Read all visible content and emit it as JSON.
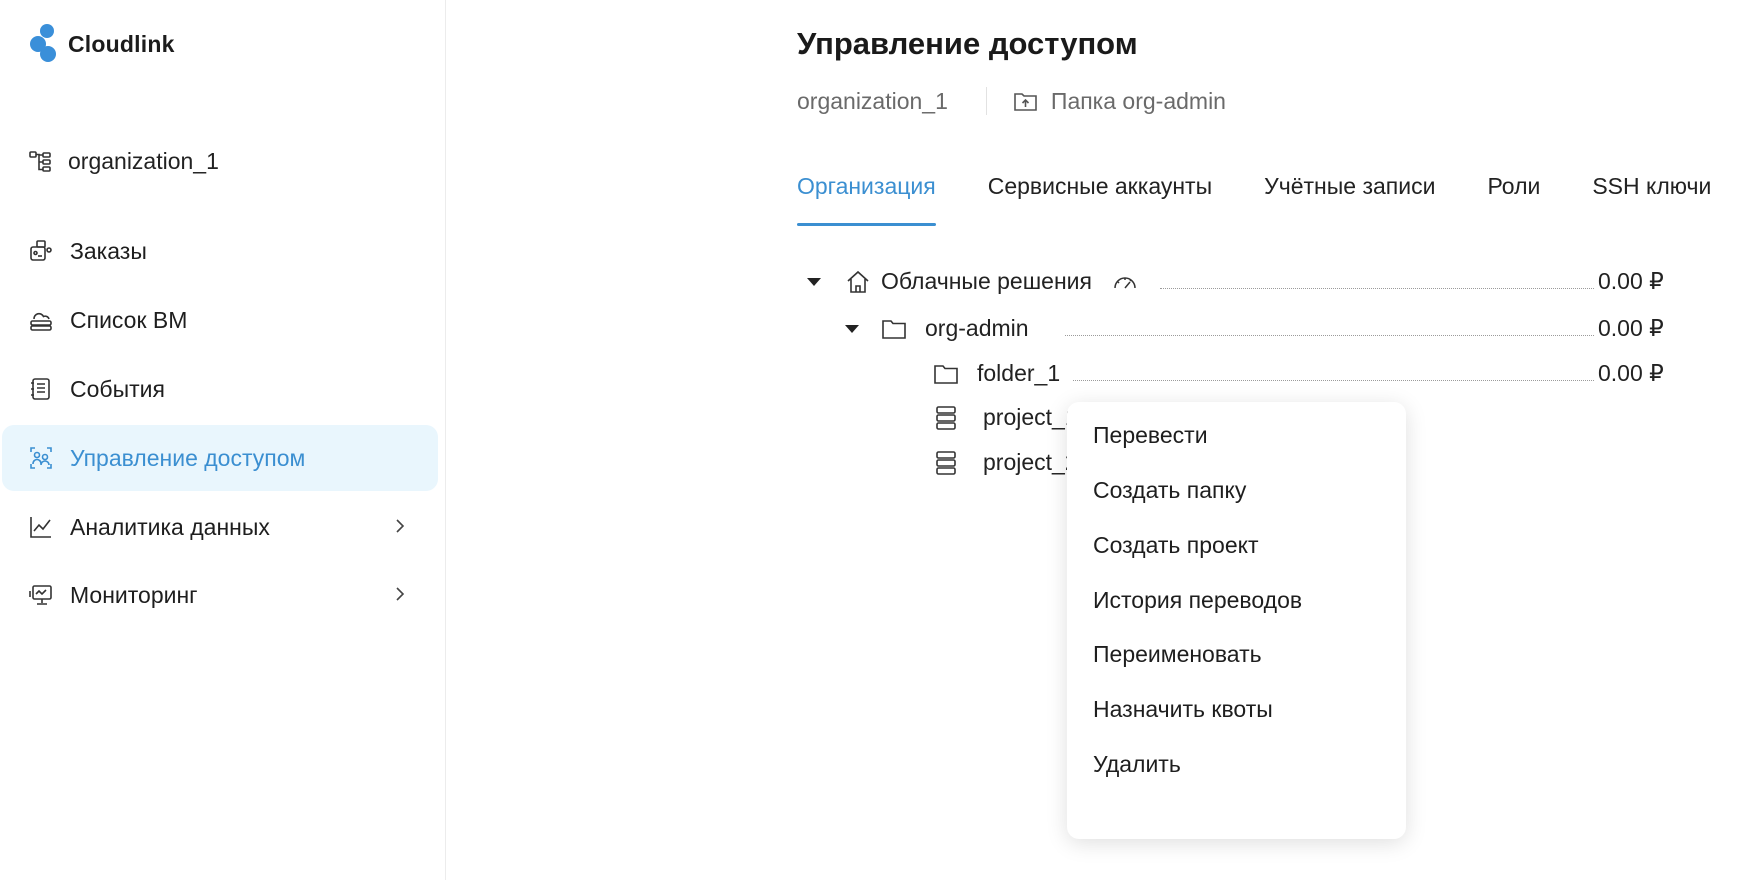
{
  "brand": {
    "name": "Cloudlink",
    "color": "#3a8fd9"
  },
  "sidebar": {
    "organization": "organization_1",
    "items": [
      {
        "label": "Заказы",
        "icon": "orders-icon"
      },
      {
        "label": "Список ВМ",
        "icon": "cloud-vm-icon"
      },
      {
        "label": "События",
        "icon": "events-icon"
      },
      {
        "label": "Управление доступом",
        "icon": "access-icon",
        "active": true
      },
      {
        "label": "Аналитика данных",
        "icon": "analytics-icon",
        "expandable": true
      },
      {
        "label": "Мониторинг",
        "icon": "monitoring-icon",
        "expandable": true
      }
    ]
  },
  "main": {
    "title": "Управление доступом",
    "breadcrumb": {
      "org": "organization_1",
      "folder": "Папка org-admin"
    },
    "tabs": [
      "Организация",
      "Сервисные аккаунты",
      "Учётные записи",
      "Роли",
      "SSH ключи"
    ],
    "active_tab": "Организация",
    "tree": [
      {
        "name": "Облачные решения",
        "price": "0.00 ₽",
        "type": "root"
      },
      {
        "name": "org-admin",
        "price": "0.00 ₽",
        "type": "folder"
      },
      {
        "name": "folder_1",
        "price": "0.00 ₽",
        "type": "folder"
      },
      {
        "name": "project_1",
        "type": "project"
      },
      {
        "name": "project_2",
        "type": "project"
      }
    ]
  },
  "context_menu": {
    "items": [
      "Перевести",
      "Создать папку",
      "Создать проект",
      "История переводов",
      "Переименовать",
      "Назначить квоты",
      "Удалить"
    ]
  },
  "colors": {
    "accent": "#3b8fd1",
    "active_bg": "#e9f6fd"
  }
}
